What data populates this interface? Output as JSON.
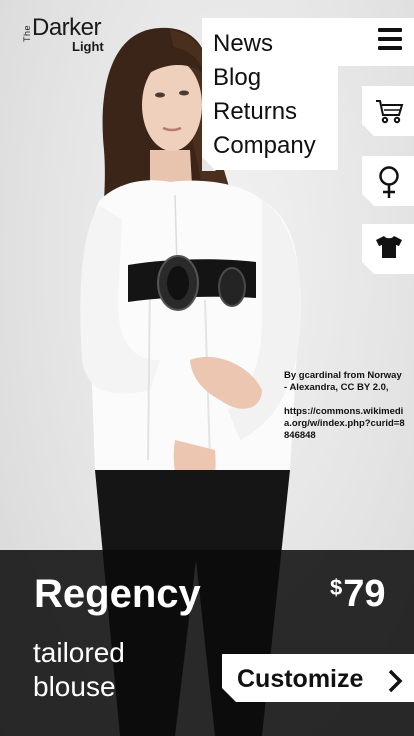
{
  "brand": {
    "the": "The",
    "darker": "Darker",
    "light": "Light"
  },
  "menu": {
    "items": [
      "News",
      "Blog",
      "Returns",
      "Company"
    ]
  },
  "side_tabs": [
    "cart-icon",
    "female-icon",
    "tshirt-icon"
  ],
  "credit": {
    "line1": "By gcardinal from Norway - Alexandra, CC BY 2.0,",
    "line2": "https://commons.wikimedia.org/w/index.php?curid=8846848"
  },
  "product": {
    "name": "Regency",
    "description": "tailored blouse",
    "currency": "$",
    "price": "79",
    "cta": "Customize"
  },
  "colors": {
    "band": "#0a0a0a",
    "panel": "#ffffff",
    "text_dark": "#111111"
  }
}
